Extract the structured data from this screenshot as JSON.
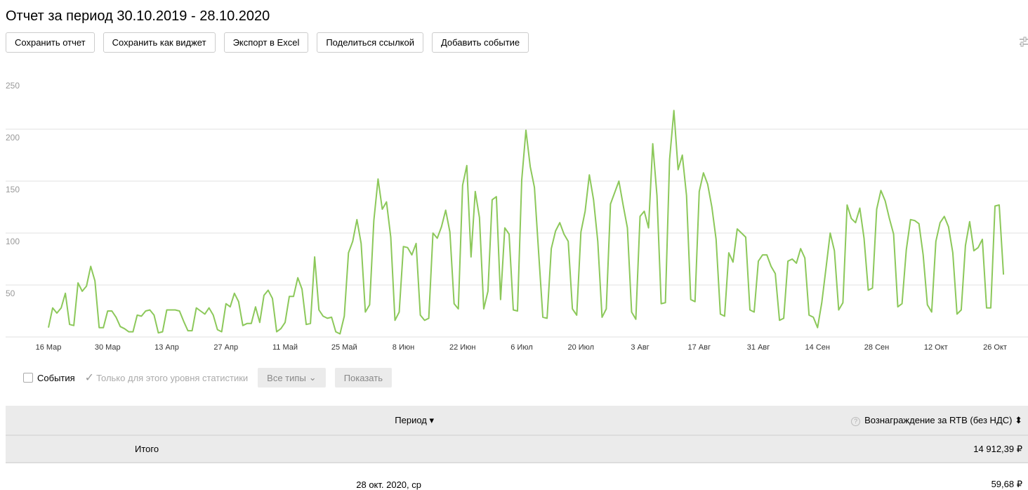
{
  "title": "Отчет за период 30.10.2019 - 28.10.2020",
  "toolbar": {
    "save": "Сохранить отчет",
    "save_widget": "Сохранить как виджет",
    "export": "Экспорт в Excel",
    "share": "Поделиться ссылкой",
    "add_event": "Добавить событие"
  },
  "controls": {
    "events": "События",
    "only_level": "Только для этого уровня статистики",
    "all_types": "Все типы",
    "show": "Показать"
  },
  "table": {
    "col_period": "Период ▾",
    "col_reward": "Вознаграждение за RTB (без НДС)",
    "sort_icon": "⬍",
    "help": "?",
    "total_label": "Итого",
    "total_value": "14 912,39 ₽",
    "row_date": "28 окт. 2020, ср",
    "row_value": "59,68 ₽"
  },
  "colors": {
    "line": "#8cc85a",
    "grid": "#e0e0e0"
  },
  "chart_data": {
    "type": "line",
    "title": "",
    "xlabel": "",
    "ylabel": "",
    "ylim": [
      0,
      250
    ],
    "yticks": [
      50,
      100,
      150,
      200,
      250
    ],
    "start_date": "16 Мар",
    "xtick_labels": [
      "16 Мар",
      "30 Мар",
      "13 Апр",
      "27 Апр",
      "11 Май",
      "25 Май",
      "8 Июн",
      "22 Июн",
      "6 Июл",
      "20 Июл",
      "3 Авг",
      "17 Авг",
      "31 Авг",
      "14 Сен",
      "28 Сен",
      "12 Окт",
      "26 Окт"
    ],
    "xtick_step_days": 14,
    "grid": true,
    "series": [
      {
        "name": "Вознаграждение за RTB (без НДС)",
        "values": [
          9,
          28,
          23,
          28,
          42,
          12,
          11,
          52,
          44,
          49,
          68,
          54,
          9,
          9,
          25,
          25,
          19,
          10,
          8,
          5,
          5,
          21,
          20,
          25,
          26,
          21,
          4,
          5,
          26,
          26,
          26,
          25,
          15,
          6,
          6,
          28,
          25,
          22,
          28,
          21,
          7,
          5,
          32,
          29,
          42,
          34,
          11,
          13,
          13,
          29,
          14,
          40,
          45,
          37,
          5,
          8,
          14,
          39,
          39,
          57,
          46,
          12,
          13,
          77,
          26,
          20,
          18,
          19,
          5,
          3,
          20,
          81,
          92,
          113,
          90,
          24,
          31,
          112,
          152,
          123,
          130,
          96,
          16,
          24,
          87,
          86,
          79,
          90,
          21,
          16,
          18,
          100,
          95,
          106,
          122,
          101,
          32,
          27,
          146,
          165,
          77,
          140,
          115,
          27,
          44,
          132,
          135,
          36,
          105,
          99,
          26,
          25,
          151,
          199,
          164,
          144,
          81,
          19,
          18,
          85,
          102,
          110,
          99,
          92,
          27,
          21,
          101,
          121,
          156,
          132,
          92,
          19,
          27,
          128,
          139,
          150,
          127,
          105,
          24,
          17,
          116,
          121,
          105,
          186,
          136,
          32,
          33,
          171,
          218,
          161,
          175,
          136,
          36,
          34,
          140,
          158,
          147,
          125,
          94,
          22,
          20,
          81,
          72,
          104,
          100,
          96,
          26,
          24,
          73,
          79,
          79,
          68,
          61,
          16,
          18,
          73,
          75,
          71,
          85,
          76,
          21,
          19,
          9,
          33,
          66,
          100,
          83,
          26,
          33,
          127,
          114,
          110,
          124,
          95,
          45,
          47,
          123,
          141,
          131,
          114,
          99,
          29,
          32,
          84,
          113,
          112,
          109,
          79,
          31,
          24,
          92,
          110,
          116,
          106,
          81,
          22,
          26,
          88,
          111,
          83,
          86,
          94,
          28,
          28,
          126,
          127,
          60
        ]
      }
    ]
  }
}
